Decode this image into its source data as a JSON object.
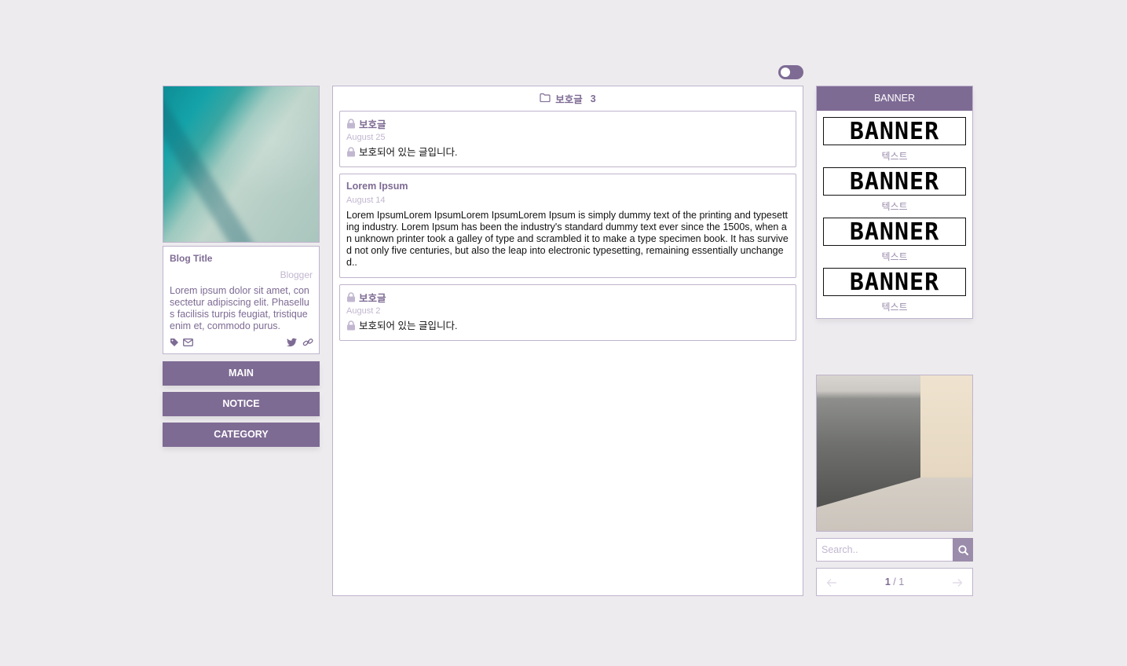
{
  "theme": {
    "accent": "#7e6b94",
    "light_accent": "#c2b7d0",
    "background": "#edebee"
  },
  "profile": {
    "blog_title": "Blog Title",
    "blogger": "Blogger",
    "description": "Lorem ipsum dolor sit amet, consectetur adipiscing elit. Phasellus facilisis turpis feugiat, tristique enim et, commodo purus.",
    "icons_left": [
      "tag-icon",
      "envelope-icon"
    ],
    "icons_right": [
      "twitter-icon",
      "link-icon"
    ]
  },
  "nav": {
    "main": "MAIN",
    "notice": "NOTICE",
    "category": "CATEGORY"
  },
  "main": {
    "category_icon": "folder-icon",
    "category_label": "보호글",
    "category_count": "3",
    "posts": [
      {
        "title": "보호글",
        "date": "August 25",
        "body": "보호되어 있는 글입니다.",
        "protected": true
      },
      {
        "title": "Lorem Ipsum",
        "date": "August 14",
        "body": "Lorem IpsumLorem IpsumLorem IpsumLorem Ipsum is simply dummy text of the printing and typesetting industry. Lorem Ipsum has been the industry's standard dummy text ever since the 1500s, when an unknown printer took a galley of type and scrambled it to make a type specimen book. It has survived not only five centuries, but also the leap into electronic typesetting, remaining essentially unchanged..",
        "protected": false
      },
      {
        "title": "보호글",
        "date": "August 2",
        "body": "보호되어 있는 글입니다.",
        "protected": true
      }
    ]
  },
  "banner": {
    "header": "BANNER",
    "items": [
      {
        "image_text": "BANNER",
        "caption": "텍스트"
      },
      {
        "image_text": "BANNER",
        "caption": "텍스트"
      },
      {
        "image_text": "BANNER",
        "caption": "텍스트"
      },
      {
        "image_text": "BANNER",
        "caption": "텍스트"
      }
    ]
  },
  "search": {
    "placeholder": "Search..",
    "value": "",
    "icon": "search-icon"
  },
  "pager": {
    "current": "1",
    "separator": " / ",
    "total": "1",
    "prev_icon": "arrow-left-icon",
    "next_icon": "arrow-right-icon"
  }
}
